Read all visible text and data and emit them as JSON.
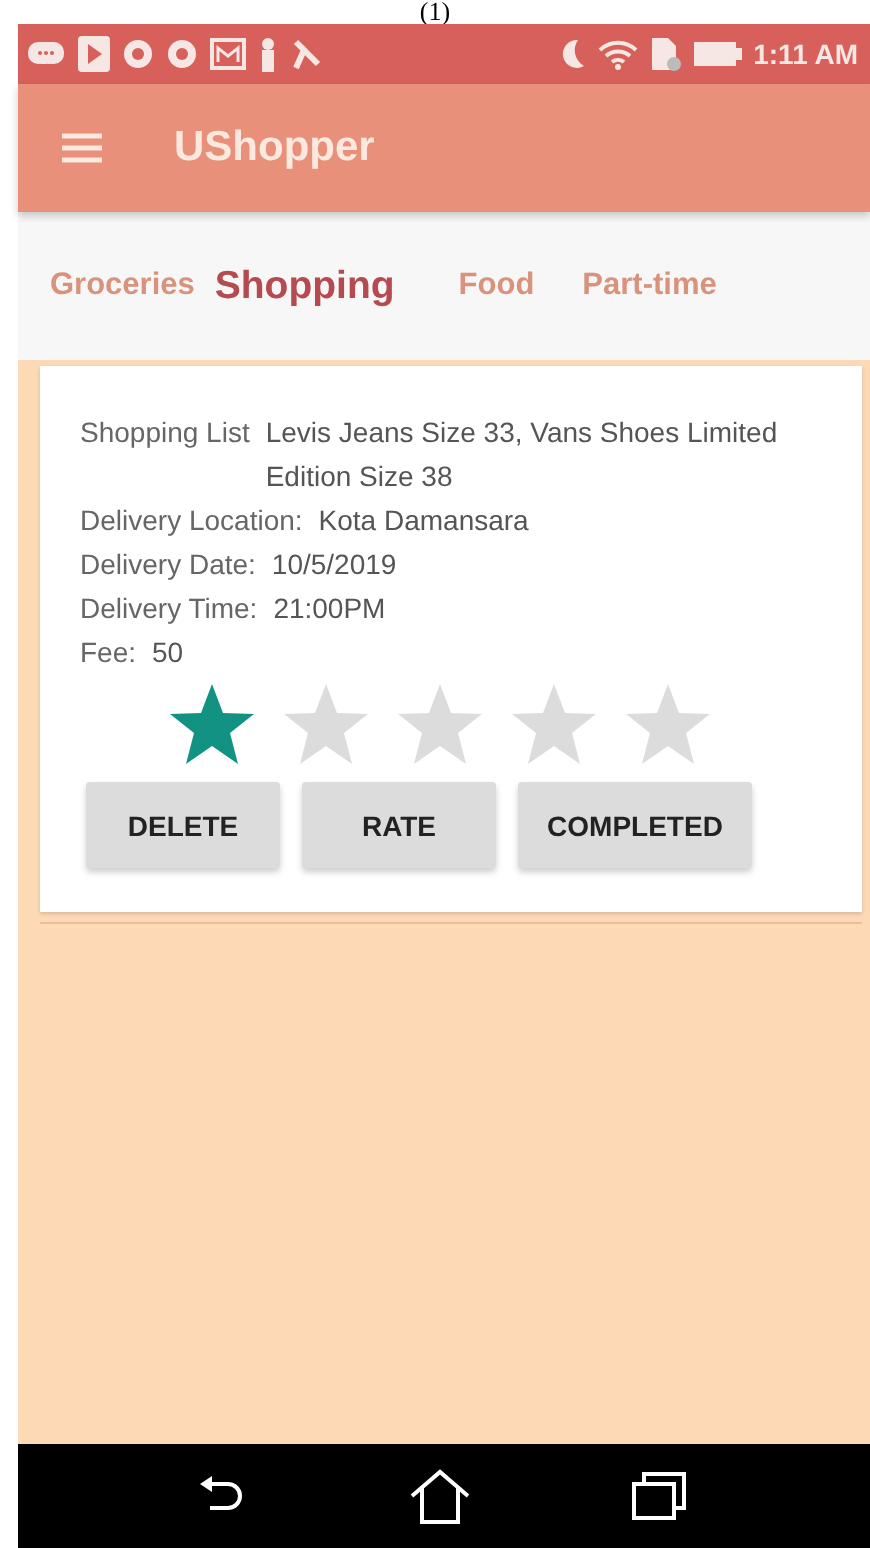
{
  "caption": "(1)",
  "status_bar": {
    "time": "1:11 AM"
  },
  "app_bar": {
    "title": "UShopper"
  },
  "tabs": [
    {
      "label": "Groceries",
      "selected": false
    },
    {
      "label": "Shopping",
      "selected": true
    },
    {
      "label": "Food",
      "selected": false
    },
    {
      "label": "Part-time",
      "selected": false
    }
  ],
  "order": {
    "fields": [
      {
        "label": "Shopping List",
        "value": "Levis Jeans Size 33, Vans Shoes Limited Edition Size 38"
      },
      {
        "label": "Delivery Location:",
        "value": "Kota Damansara"
      },
      {
        "label": "Delivery Date:",
        "value": "10/5/2019"
      },
      {
        "label": "Delivery Time:",
        "value": "21:00PM"
      },
      {
        "label": "Fee:",
        "value": "50"
      }
    ],
    "stars": 1,
    "buttons": [
      "DELETE",
      "RATE",
      "COMPLETED"
    ]
  }
}
